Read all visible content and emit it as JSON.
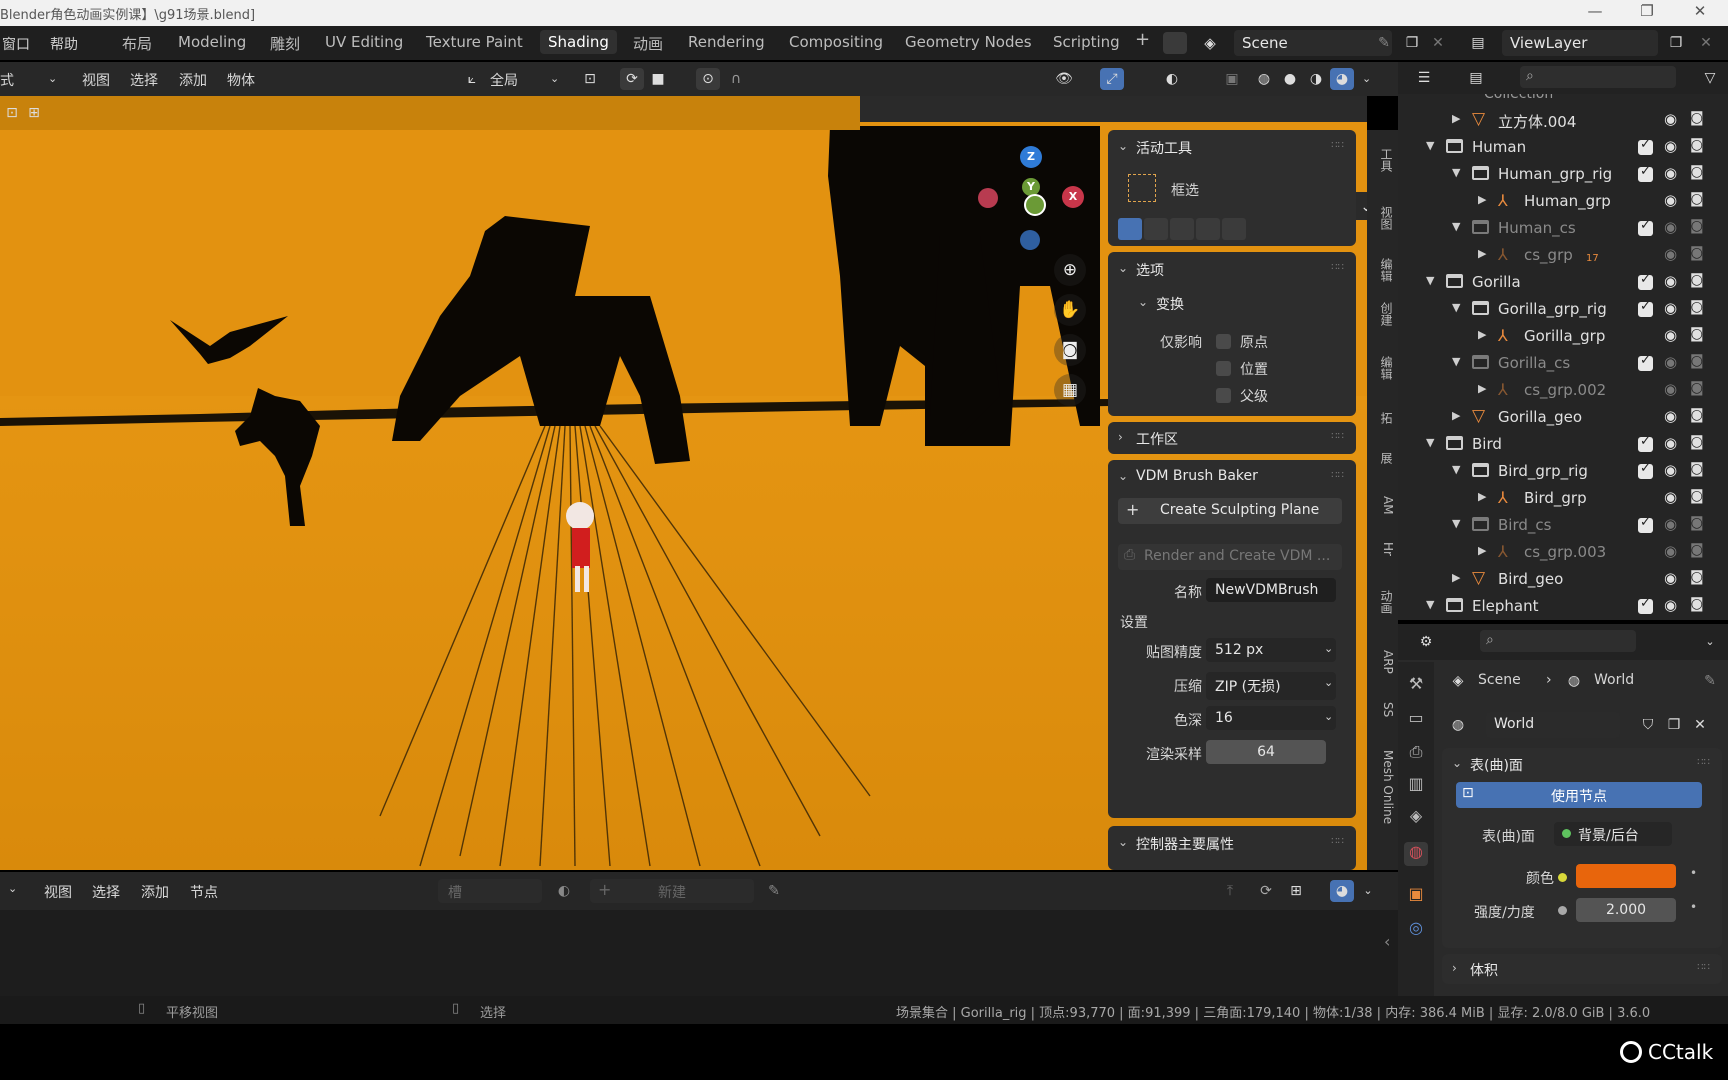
{
  "window": {
    "title": "Blender角色动画实例课】\\g91场景.blend]",
    "controls": [
      "—",
      "❐",
      "✕"
    ]
  },
  "topbar": {
    "menus": [
      "窗口",
      "帮助"
    ],
    "workspaces": [
      "布局",
      "Modeling",
      "雕刻",
      "UV Editing",
      "Texture Paint",
      "Shading",
      "动画",
      "Rendering",
      "Compositing",
      "Geometry Nodes",
      "Scripting"
    ],
    "active_workspace": "Shading",
    "add_tab": "+",
    "scene_name": "Scene",
    "view_layer": "ViewLayer"
  },
  "viewport_header": {
    "mode_suffix": "式",
    "menus": [
      "视图",
      "选择",
      "添加",
      "物体"
    ],
    "transform_orientation": "全局",
    "options_button": "选项"
  },
  "gizmo": {
    "z": "Z",
    "y": "Y",
    "x": "X"
  },
  "npanel": {
    "active_tool": {
      "title": "活动工具",
      "tool_name": "框选"
    },
    "options": {
      "title": "选项",
      "transform_title": "变换",
      "affect_only": "仅影响",
      "checkboxes": [
        "原点",
        "位置",
        "父级"
      ]
    },
    "workspace": {
      "title": "工作区"
    },
    "vdm": {
      "title": "VDM Brush Baker",
      "create_button": "Create Sculpting Plane",
      "render_button": "Render and Create VDM ...",
      "name_label": "名称",
      "name_value": "NewVDMBrush",
      "settings_label": "设置",
      "resolution_label": "贴图精度",
      "resolution_value": "512 px",
      "compression_label": "压缩",
      "compression_value": "ZIP (无损)",
      "depth_label": "色深",
      "depth_value": "16",
      "samples_label": "渲染采样",
      "samples_value": "64"
    },
    "controller": {
      "title": "控制器主要属性"
    }
  },
  "vertical_tabs": [
    "工具",
    "视图",
    "编辑",
    "创建",
    "编辑",
    "拓",
    "展",
    "AM",
    "Hr",
    "动画",
    "ARP",
    "SS",
    "Mesh Online"
  ],
  "outliner": {
    "partial_top": "Collection",
    "rows": [
      {
        "indent": 1,
        "type": "mesh",
        "name": "立方体.004",
        "expanded": false,
        "dim": false,
        "check": false
      },
      {
        "indent": 0,
        "type": "collection",
        "name": "Human",
        "expanded": true,
        "dim": false,
        "check": true
      },
      {
        "indent": 1,
        "type": "collection",
        "name": "Human_grp_rig",
        "expanded": true,
        "dim": false,
        "check": true
      },
      {
        "indent": 2,
        "type": "armature",
        "name": "Human_grp",
        "expanded": false,
        "dim": false,
        "check": false
      },
      {
        "indent": 1,
        "type": "collection",
        "name": "Human_cs",
        "expanded": true,
        "dim": true,
        "check": true
      },
      {
        "indent": 2,
        "type": "armature",
        "name": "cs_grp",
        "expanded": false,
        "dim": true,
        "check": false,
        "badge": "17"
      },
      {
        "indent": 0,
        "type": "collection",
        "name": "Gorilla",
        "expanded": true,
        "dim": false,
        "check": true
      },
      {
        "indent": 1,
        "type": "collection",
        "name": "Gorilla_grp_rig",
        "expanded": true,
        "dim": false,
        "check": true
      },
      {
        "indent": 2,
        "type": "armature",
        "name": "Gorilla_grp",
        "expanded": false,
        "dim": false,
        "check": false
      },
      {
        "indent": 1,
        "type": "collection",
        "name": "Gorilla_cs",
        "expanded": true,
        "dim": true,
        "check": true
      },
      {
        "indent": 2,
        "type": "armature",
        "name": "cs_grp.002",
        "expanded": false,
        "dim": true,
        "check": false
      },
      {
        "indent": 1,
        "type": "mesh",
        "name": "Gorilla_geo",
        "expanded": false,
        "dim": false,
        "check": false
      },
      {
        "indent": 0,
        "type": "collection",
        "name": "Bird",
        "expanded": true,
        "dim": false,
        "check": true
      },
      {
        "indent": 1,
        "type": "collection",
        "name": "Bird_grp_rig",
        "expanded": true,
        "dim": false,
        "check": true
      },
      {
        "indent": 2,
        "type": "armature",
        "name": "Bird_grp",
        "expanded": false,
        "dim": false,
        "check": false
      },
      {
        "indent": 1,
        "type": "collection",
        "name": "Bird_cs",
        "expanded": true,
        "dim": true,
        "check": true
      },
      {
        "indent": 2,
        "type": "armature",
        "name": "cs_grp.003",
        "expanded": false,
        "dim": true,
        "check": false
      },
      {
        "indent": 1,
        "type": "mesh",
        "name": "Bird_geo",
        "expanded": false,
        "dim": false,
        "check": false
      },
      {
        "indent": 0,
        "type": "collection",
        "name": "Elephant",
        "expanded": true,
        "dim": false,
        "check": true
      }
    ]
  },
  "properties": {
    "breadcrumb_scene": "Scene",
    "breadcrumb_world": "World",
    "world_name": "World",
    "surface_title": "表(曲)面",
    "use_nodes_button": "使用节点",
    "surface_label": "表(曲)面",
    "surface_value": "背景/后台",
    "color_label": "颜色",
    "color_value": "#e8650c",
    "strength_label": "强度/力度",
    "strength_value": "2.000",
    "volume_title": "体积"
  },
  "timeline_header": {
    "menus": [
      "视图",
      "选择",
      "添加",
      "节点"
    ],
    "slot_placeholder": "槽",
    "new_button": "新建"
  },
  "status": {
    "left_hint": "平移视图",
    "mid_hint": "选择",
    "stats": "场景集合 | Gorilla_rig | 顶点:93,770 | 面:91,399 | 三角面:179,140 | 物体:1/38 | 内存: 386.4 MiB | 显存: 2.0/8.0 GiB | 3.6.0"
  },
  "watermark": "CCtalk",
  "colors": {
    "viewport_bg": "#e2920c",
    "accent_blue": "#4772b3",
    "active_ws": "#303030"
  }
}
